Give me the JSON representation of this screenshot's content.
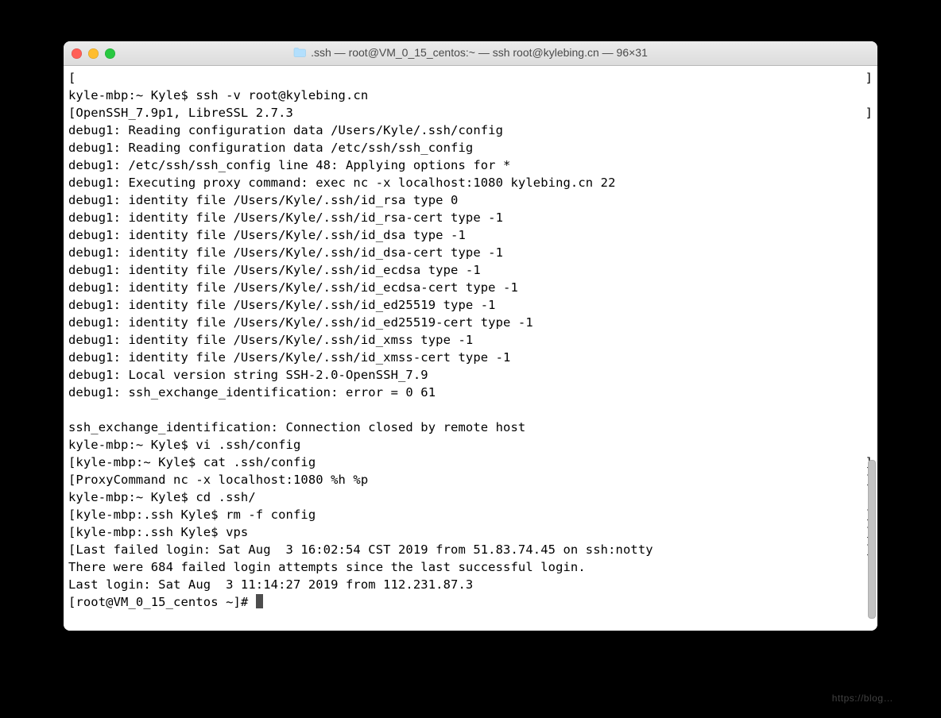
{
  "window": {
    "title": ".ssh — root@VM_0_15_centos:~ — ssh root@kylebing.cn — 96×31"
  },
  "terminal": {
    "prompt_final": "[root@VM_0_15_centos ~]# ",
    "lines": [
      {
        "left": "[",
        "right": "]"
      },
      {
        "left": "kyle-mbp:~ Kyle$ ssh -v root@kylebing.cn"
      },
      {
        "left": "[OpenSSH_7.9p1, LibreSSL 2.7.3",
        "right": "]"
      },
      {
        "left": "debug1: Reading configuration data /Users/Kyle/.ssh/config"
      },
      {
        "left": "debug1: Reading configuration data /etc/ssh/ssh_config"
      },
      {
        "left": "debug1: /etc/ssh/ssh_config line 48: Applying options for *"
      },
      {
        "left": "debug1: Executing proxy command: exec nc -x localhost:1080 kylebing.cn 22"
      },
      {
        "left": "debug1: identity file /Users/Kyle/.ssh/id_rsa type 0"
      },
      {
        "left": "debug1: identity file /Users/Kyle/.ssh/id_rsa-cert type -1"
      },
      {
        "left": "debug1: identity file /Users/Kyle/.ssh/id_dsa type -1"
      },
      {
        "left": "debug1: identity file /Users/Kyle/.ssh/id_dsa-cert type -1"
      },
      {
        "left": "debug1: identity file /Users/Kyle/.ssh/id_ecdsa type -1"
      },
      {
        "left": "debug1: identity file /Users/Kyle/.ssh/id_ecdsa-cert type -1"
      },
      {
        "left": "debug1: identity file /Users/Kyle/.ssh/id_ed25519 type -1"
      },
      {
        "left": "debug1: identity file /Users/Kyle/.ssh/id_ed25519-cert type -1"
      },
      {
        "left": "debug1: identity file /Users/Kyle/.ssh/id_xmss type -1"
      },
      {
        "left": "debug1: identity file /Users/Kyle/.ssh/id_xmss-cert type -1"
      },
      {
        "left": "debug1: Local version string SSH-2.0-OpenSSH_7.9"
      },
      {
        "left": "debug1: ssh_exchange_identification: error = 0 61"
      },
      {
        "left": ""
      },
      {
        "left": "ssh_exchange_identification: Connection closed by remote host"
      },
      {
        "left": "kyle-mbp:~ Kyle$ vi .ssh/config"
      },
      {
        "left": "[kyle-mbp:~ Kyle$ cat .ssh/config",
        "right": "]"
      },
      {
        "left": "[ProxyCommand nc -x localhost:1080 %h %p",
        "right": "]"
      },
      {
        "left": "kyle-mbp:~ Kyle$ cd .ssh/"
      },
      {
        "left": "[kyle-mbp:.ssh Kyle$ rm -f config",
        "right": "]"
      },
      {
        "left": "[kyle-mbp:.ssh Kyle$ vps",
        "right": "]"
      },
      {
        "left": "[Last failed login: Sat Aug  3 16:02:54 CST 2019 from 51.83.74.45 on ssh:notty",
        "right": "]"
      },
      {
        "left": "There were 684 failed login attempts since the last successful login."
      },
      {
        "left": "Last login: Sat Aug  3 11:14:27 2019 from 112.231.87.3"
      }
    ]
  },
  "watermark": "https://blog…"
}
